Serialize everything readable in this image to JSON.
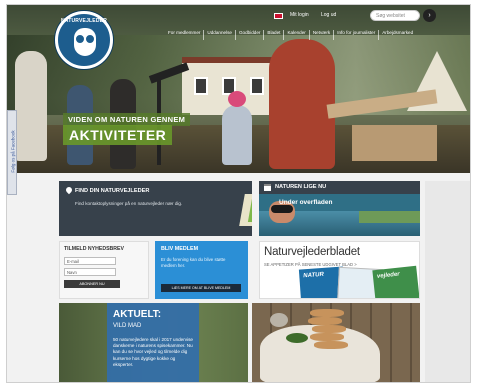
{
  "header": {
    "logo_text": "NATURVEJLEDER",
    "login_label": "Mit login",
    "login2_label": "Log ud",
    "search_placeholder": "Søg websitet",
    "search_button": "›",
    "facebook_tab": "Følg os på Facebook"
  },
  "nav": {
    "items": [
      "For medlemmer",
      "Uddannelse",
      "Godbidder",
      "Bladet",
      "Kalender",
      "Netværk",
      "Info for journalister",
      "Arbejdsmarked"
    ]
  },
  "hero": {
    "tag": "VIDEN OM NATUREN GENNEM",
    "title": "AKTIVITETER"
  },
  "find_box": {
    "heading": "FIND DIN NATURVEJLEDER",
    "text": "Find kontaktoplysninger på en naturvejleder nær dig."
  },
  "nature_box": {
    "heading": "NATUREN LIGE NU",
    "subtitle": "Under overfladen"
  },
  "newsletter": {
    "heading": "TILMELD NYHEDSBREV",
    "email_placeholder": "E-mail",
    "name_placeholder": "Navn",
    "button": "ABONNER NU"
  },
  "member": {
    "heading": "BLIV MEDLEM",
    "text": "Er du forening kan du blive støtte medlem her.",
    "button": "LÆS MERE OM AT BLIVE MEDLEM"
  },
  "magazine": {
    "heading": "Naturvejlederbladet",
    "subtitle": "SE APPETIZER PÅ SENESTE UDGIVET BLAD >",
    "cover1": "NATUR",
    "cover3": "vejleder"
  },
  "aktuelt": {
    "heading": "AKTUELT:",
    "subtitle": "VILD MAD",
    "text": "50 naturvejledere skal i 2017 undervise danskerne i naturens spisekammer. Nu kan du se hvor vejled og tilmelde dig kurserne hos dygtige kokke og eksperter."
  },
  "colors": {
    "hero_tag_bg": "#567a2a",
    "hero_title_bg": "#68962a",
    "dark_box": "#37414b",
    "member_blue": "#2b8fd6",
    "aktuelt_blue": "#326eaa",
    "logo_blue": "#1d5d8e"
  },
  "icons": [
    "owl-logo-icon",
    "flag-icon",
    "search-icon",
    "location-pin-icon",
    "map-icon",
    "calendar-icon"
  ]
}
